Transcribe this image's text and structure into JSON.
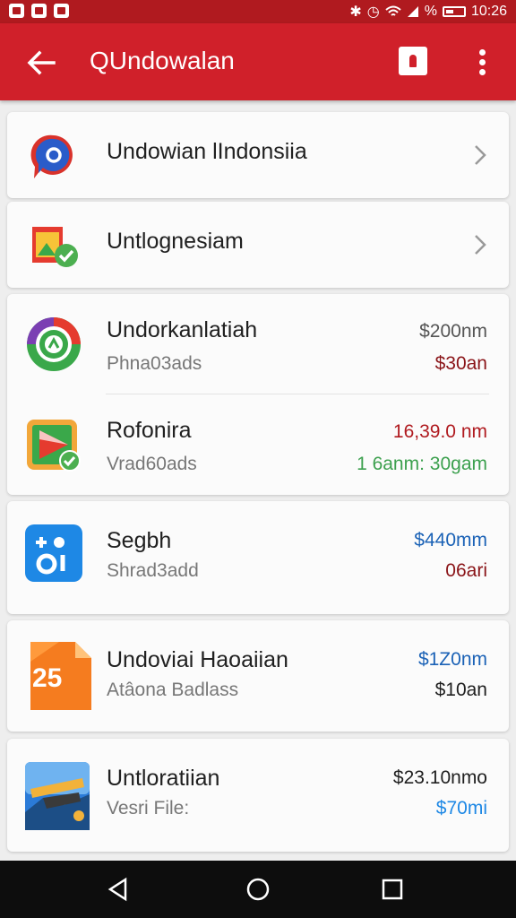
{
  "status_bar": {
    "time": "10:26",
    "battery_text": "%"
  },
  "app_bar": {
    "title": "QUndowalan"
  },
  "items": [
    {
      "title": "Undowian lIndonsiia",
      "icon": "chat-bubble-icon"
    },
    {
      "title": "Untlognesiam",
      "icon": "photo-check-icon"
    },
    {
      "title": "Undorkanlatiah",
      "subtitle": "Phna03ads",
      "value1": "$200nm",
      "value2": "$30an",
      "icon": "chrome-circle-icon"
    },
    {
      "title": "Rofonira",
      "subtitle": "Vrad60ads",
      "value1": "16,39.0 nm",
      "value2": "1 6anm: 30gam",
      "icon": "play-store-icon"
    },
    {
      "title": "Segbh",
      "subtitle": "Shrad3add",
      "value1": "$440mm",
      "value2": "06ari",
      "icon": "blue-app-icon"
    },
    {
      "title": "Undoviai Haoaiian",
      "subtitle": "Atâona Badlass",
      "value1": "$1Z0nm",
      "value2": "$10an",
      "icon": "document-icon"
    },
    {
      "title": "Untloratiian",
      "subtitle": "Vesri File:",
      "value1": "$23.10nmo",
      "value2": "$70mi",
      "icon": "photo-thumbnail-icon"
    }
  ],
  "colors": {
    "primary": "#d0202a",
    "status": "#b01a1f",
    "red_value": "#b01a1f",
    "green_value": "#3ca04e",
    "blue_value": "#1b62b6",
    "dark_value": "#202020",
    "nav": "#0d0d0d"
  }
}
